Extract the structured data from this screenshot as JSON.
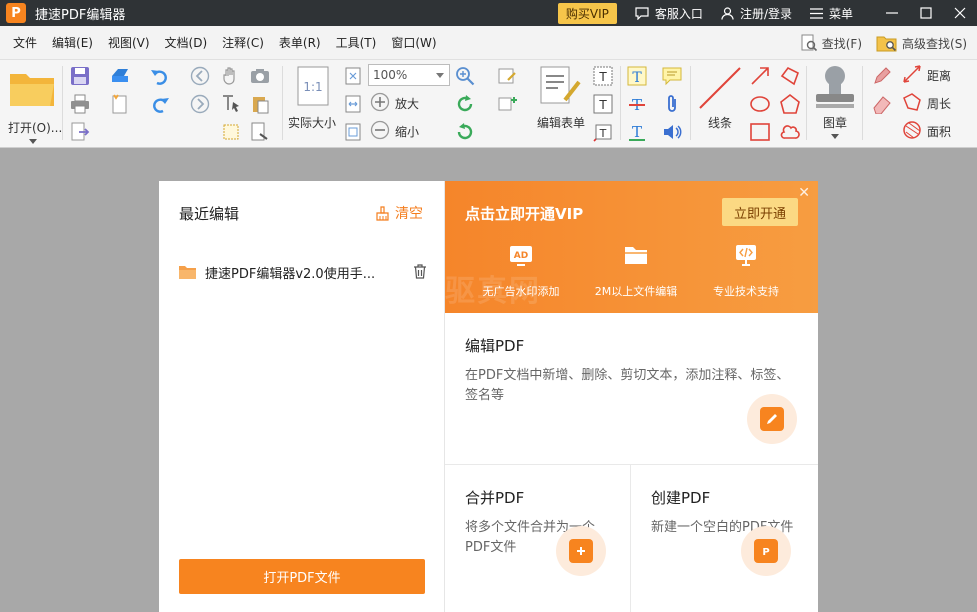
{
  "window": {
    "logo_letter": "P",
    "title": "捷速PDF编辑器",
    "buy_vip": "购买VIP",
    "service": "客服入口",
    "register": "注册/登录",
    "menu": "菜单"
  },
  "menubar": {
    "items": [
      "文件",
      "编辑(E)",
      "视图(V)",
      "文档(D)",
      "注释(C)",
      "表单(R)",
      "工具(T)",
      "窗口(W)"
    ],
    "find": "查找(F)",
    "advanced_find": "高级查找(S)"
  },
  "ribbon": {
    "open": "打开(O)...",
    "actual_size": "实际大小",
    "zoom_value": "100%",
    "zoom_in": "放大",
    "zoom_out": "缩小",
    "edit_form": "编辑表单",
    "lines": "线条",
    "stamp": "图章",
    "distance": "距离",
    "perimeter": "周长",
    "area": "面积"
  },
  "recent": {
    "title": "最近编辑",
    "clear": "清空",
    "files": [
      "捷速PDF编辑器v2.0使用手..."
    ],
    "open_button": "打开PDF文件"
  },
  "vip": {
    "headline": "点击立即开通VIP",
    "open_now": "立即开通",
    "watermark": "驱真网",
    "benefits": [
      {
        "icon": "ad-icon",
        "label": "无广告水印添加"
      },
      {
        "icon": "folder-icon",
        "label": "2M以上文件编辑"
      },
      {
        "icon": "support-icon",
        "label": "专业技术支持"
      }
    ]
  },
  "cards": {
    "edit": {
      "title": "编辑PDF",
      "desc": "在PDF文档中新增、删除、剪切文本，添加注释、标签、签名等"
    },
    "merge": {
      "title": "合并PDF",
      "desc": "将多个文件合并为一个PDF文件"
    },
    "create": {
      "title": "创建PDF",
      "desc": "新建一个空白的PDF文件"
    }
  },
  "colors": {
    "accent": "#f7841f",
    "titlebar": "#2f3336",
    "vip_button": "#f6c54a"
  }
}
